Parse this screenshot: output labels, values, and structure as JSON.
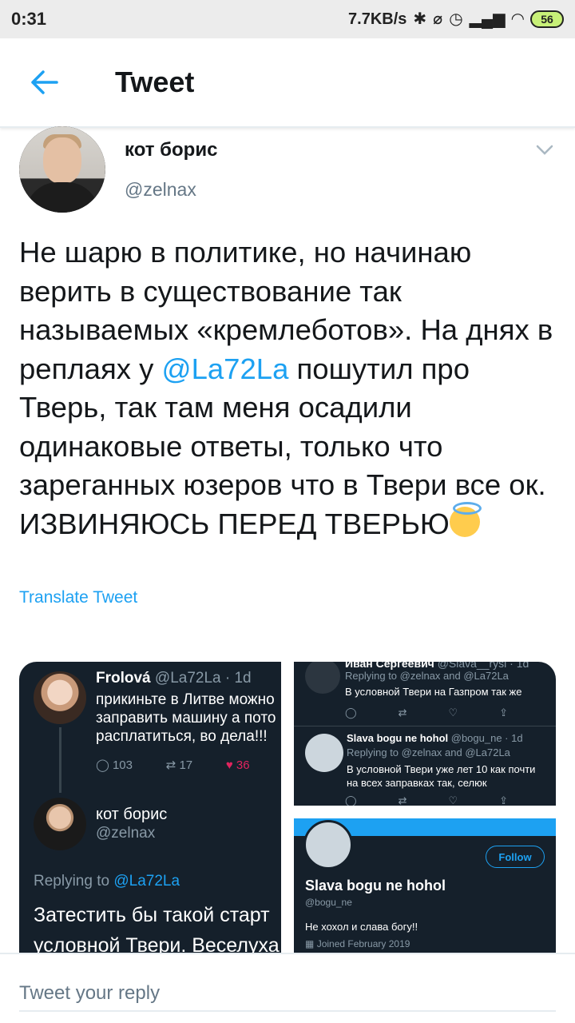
{
  "status_bar": {
    "time": "0:31",
    "network_speed": "7.7KB/s",
    "battery": "56"
  },
  "header": {
    "title": "Tweet"
  },
  "tweet": {
    "author_name": "кот борис",
    "author_handle": "@zelnax",
    "text_1": "Не шарю в политике, но начинаю верить в существование так называемых «кремлеботов». На днях в реплаях у ",
    "mention": "@La72La",
    "text_2": " пошутил про Тверь, так там меня осадили одинаковые ответы, только что зареганных юзеров что в Твери все ок. ИЗВИНЯЮСЬ ПЕРЕД ТВЕРЬЮ",
    "translate_label": "Translate Tweet"
  },
  "media_left": {
    "name": "Frolová",
    "handle_time": "@La72La · 1d",
    "text": "прикиньте в Литве можно\nзаправить машину а пото\nрасплатиться, во дела!!!",
    "replies": "103",
    "retweets": "17",
    "likes": "36",
    "reply_name": "кот борис",
    "reply_handle": "@zelnax",
    "replying_prefix": "Replying to",
    "replying_to": "@La72La",
    "reply_text": "Затестить бы такой старт\nусловной Твери. Веселуха"
  },
  "media_right_top": {
    "name_cut": "Иван Сергеевич",
    "handle_cut": "@Slava__rysi · 1d",
    "replying": "Replying to @zelnax and @La72La",
    "text1": "В условной Твери на Газпром так же",
    "name2": "Slava bogu ne hohol",
    "handle2": "@bogu_ne · 1d",
    "replying2": "Replying to @zelnax and @La72La",
    "text2": "В условной Твери уже лет 10 как почти\nна всех заправках так, селюк"
  },
  "media_right_bottom": {
    "follow_label": "Follow",
    "name": "Slava bogu ne hohol",
    "handle": "@bogu_ne",
    "bio": "Не хохол и слава богу!!",
    "joined": "Joined February 2019"
  },
  "reply": {
    "placeholder": "Tweet your reply"
  },
  "colors": {
    "accent": "#1da1f2",
    "dark_card": "#15202b"
  }
}
